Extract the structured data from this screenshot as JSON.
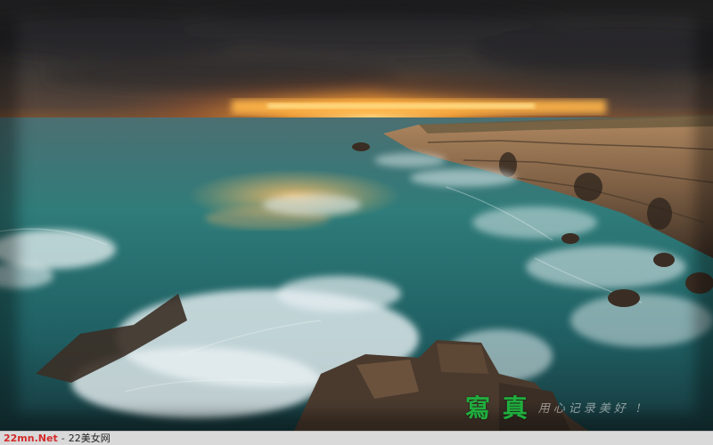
{
  "scene": {
    "description_icon": "sunset-sea-cliff-photo",
    "colors": {
      "sky_dark": "#2b2a2b",
      "sunset_glow": "#f2a23a",
      "sea_teal": "#2f7f7f",
      "sea_deep": "#1c4d55",
      "foam": "#e8f0f2",
      "cliff": "#8a6a4d"
    }
  },
  "watermark": {
    "main_text": "寫 真",
    "sub_text": "用心记录美好 !"
  },
  "footer": {
    "site": "22mn.Net",
    "separator": "-",
    "site_name": "22美女网"
  }
}
